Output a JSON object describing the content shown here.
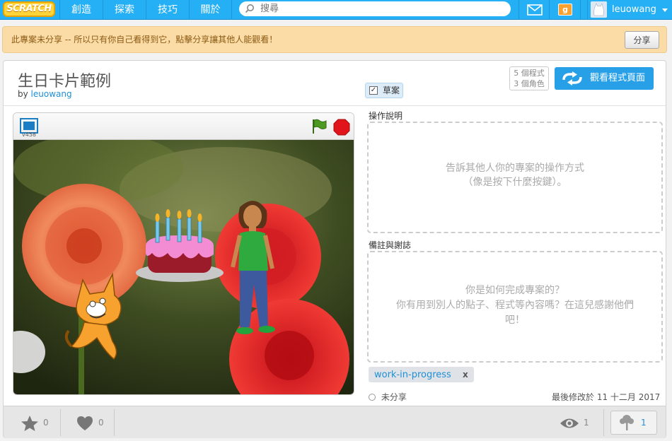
{
  "nav": {
    "logo": "SCRATCH",
    "items": [
      "創造",
      "探索",
      "技巧",
      "關於"
    ],
    "search_placeholder": "搜尋",
    "mystuff_glyph": "g",
    "username": "leuowang"
  },
  "banner": {
    "text": "此專案未分享 -- 所以只有你自己看得到它，點擊分享讓其他人能觀看！",
    "share_label": "分享"
  },
  "project": {
    "title": "生日卡片範例",
    "by_prefix": "by",
    "author": "leuowang",
    "draft_label": "草案",
    "draft_checked": "✓",
    "scripts_count": "5 個程式",
    "sprites_count": "3 個角色",
    "see_inside_label": "觀看程式頁面"
  },
  "player": {
    "version": "v458"
  },
  "instructions": {
    "label": "操作說明",
    "placeholder_line1": "告訴其他人你的專案的操作方式",
    "placeholder_line2": "（像是按下什麼按鍵）。"
  },
  "notes": {
    "label": "備註與謝誌",
    "placeholder_line1": "你是如何完成專案的？",
    "placeholder_line2": "你有用到別人的點子、程式等內容嗎？在這兒感謝他們",
    "placeholder_line3": "吧！"
  },
  "tags": [
    {
      "label": "work-in-progress",
      "remove": "x"
    }
  ],
  "status": {
    "shared": "未分享",
    "modified": "最後修改於 11 十二月 2017"
  },
  "stats": {
    "favorites": "0",
    "loves": "0",
    "views": "1",
    "remixes": "1"
  },
  "colors": {
    "nav_blue": "#25aff4",
    "banner_bg": "#fbdca6",
    "button_blue": "#27a0e8",
    "link_blue": "#1e8fd6"
  }
}
